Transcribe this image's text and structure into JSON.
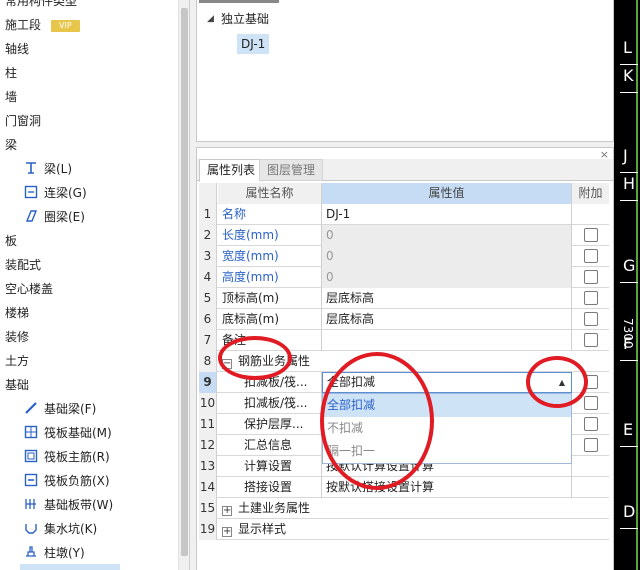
{
  "left_tree": {
    "items": [
      {
        "label": "常用构件类型",
        "level": 0
      },
      {
        "label": "施工段",
        "level": 0,
        "badge": "VIP"
      },
      {
        "label": "轴线",
        "level": 0
      },
      {
        "label": "柱",
        "level": 0
      },
      {
        "label": "墙",
        "level": 0
      },
      {
        "label": "门窗洞",
        "level": 0
      },
      {
        "label": "梁",
        "level": 0
      },
      {
        "label": "梁(L)",
        "level": 1,
        "icon": "beam-icon"
      },
      {
        "label": "连梁(G)",
        "level": 1,
        "icon": "link-beam-icon"
      },
      {
        "label": "圈梁(E)",
        "level": 1,
        "icon": "ring-beam-icon"
      },
      {
        "label": "板",
        "level": 0
      },
      {
        "label": "装配式",
        "level": 0
      },
      {
        "label": "空心楼盖",
        "level": 0
      },
      {
        "label": "楼梯",
        "level": 0
      },
      {
        "label": "装修",
        "level": 0
      },
      {
        "label": "土方",
        "level": 0
      },
      {
        "label": "基础",
        "level": 0
      },
      {
        "label": "基础梁(F)",
        "level": 1,
        "icon": "foundation-beam-icon"
      },
      {
        "label": "筏板基础(M)",
        "level": 1,
        "icon": "raft-foundation-icon"
      },
      {
        "label": "筏板主筋(R)",
        "level": 1,
        "icon": "raft-main-rebar-icon"
      },
      {
        "label": "筏板负筋(X)",
        "level": 1,
        "icon": "raft-neg-rebar-icon"
      },
      {
        "label": "基础板带(W)",
        "level": 1,
        "icon": "foundation-strip-icon"
      },
      {
        "label": "集水坑(K)",
        "level": 1,
        "icon": "sump-pit-icon"
      },
      {
        "label": "柱墩(Y)",
        "level": 1,
        "icon": "column-pier-icon"
      }
    ]
  },
  "component_tree": {
    "root": "独立基础",
    "child": "DJ-1"
  },
  "property_panel": {
    "tabs": [
      "属性列表",
      "图层管理"
    ],
    "close_glyph": "×",
    "headers": {
      "name": "属性名称",
      "value": "属性值",
      "add": "附加"
    },
    "rows": [
      {
        "num": "1",
        "name": "名称",
        "value": "DJ-1",
        "blue": true,
        "check": false,
        "gray": false
      },
      {
        "num": "2",
        "name": "长度(mm)",
        "value": "0",
        "blue": true,
        "check": true,
        "gray": true
      },
      {
        "num": "3",
        "name": "宽度(mm)",
        "value": "0",
        "blue": true,
        "check": true,
        "gray": true
      },
      {
        "num": "4",
        "name": "高度(mm)",
        "value": "0",
        "blue": true,
        "check": true,
        "gray": true
      },
      {
        "num": "5",
        "name": "顶标高(m)",
        "value": "层底标高",
        "blue": false,
        "check": true,
        "gray": false
      },
      {
        "num": "6",
        "name": "底标高(m)",
        "value": "层底标高",
        "blue": false,
        "check": true,
        "gray": false
      },
      {
        "num": "7",
        "name": "备注",
        "value": "",
        "blue": false,
        "check": true,
        "gray": false
      },
      {
        "num": "8",
        "name": "钢筋业务属性",
        "group": true,
        "sign": "−"
      },
      {
        "num": "9",
        "name": "扣减板/筏...",
        "value": "全部扣减",
        "indent": true,
        "check": true,
        "selected": true
      },
      {
        "num": "10",
        "name": "扣减板/筏...",
        "value": "",
        "indent": true,
        "check": true
      },
      {
        "num": "11",
        "name": "保护层厚...",
        "value": "",
        "indent": true,
        "check": true
      },
      {
        "num": "12",
        "name": "汇总信息",
        "value": "",
        "indent": true,
        "check": true
      },
      {
        "num": "13",
        "name": "计算设置",
        "value": "按默认计算设置计算",
        "indent": true,
        "check": false
      },
      {
        "num": "14",
        "name": "搭接设置",
        "value": "按默认搭接设置计算",
        "indent": true,
        "check": false
      },
      {
        "num": "15",
        "name": "土建业务属性",
        "group": true,
        "sign": "+"
      },
      {
        "num": "19",
        "name": "显示样式",
        "group": true,
        "sign": "+"
      }
    ],
    "dropdown": {
      "arrow_glyph": "▲",
      "options": [
        "全部扣减",
        "不扣减",
        "隔一扣一"
      ],
      "highlighted": 0
    }
  },
  "cad_canvas": {
    "labels": [
      "L",
      "K",
      "J",
      "H",
      "G",
      "F",
      "E",
      "D"
    ],
    "dimension_text": "7300"
  },
  "colors": {
    "accent_blue": "#2a62c7",
    "header_blue": "#c5dcf4",
    "annotation_red": "#e01b24"
  }
}
